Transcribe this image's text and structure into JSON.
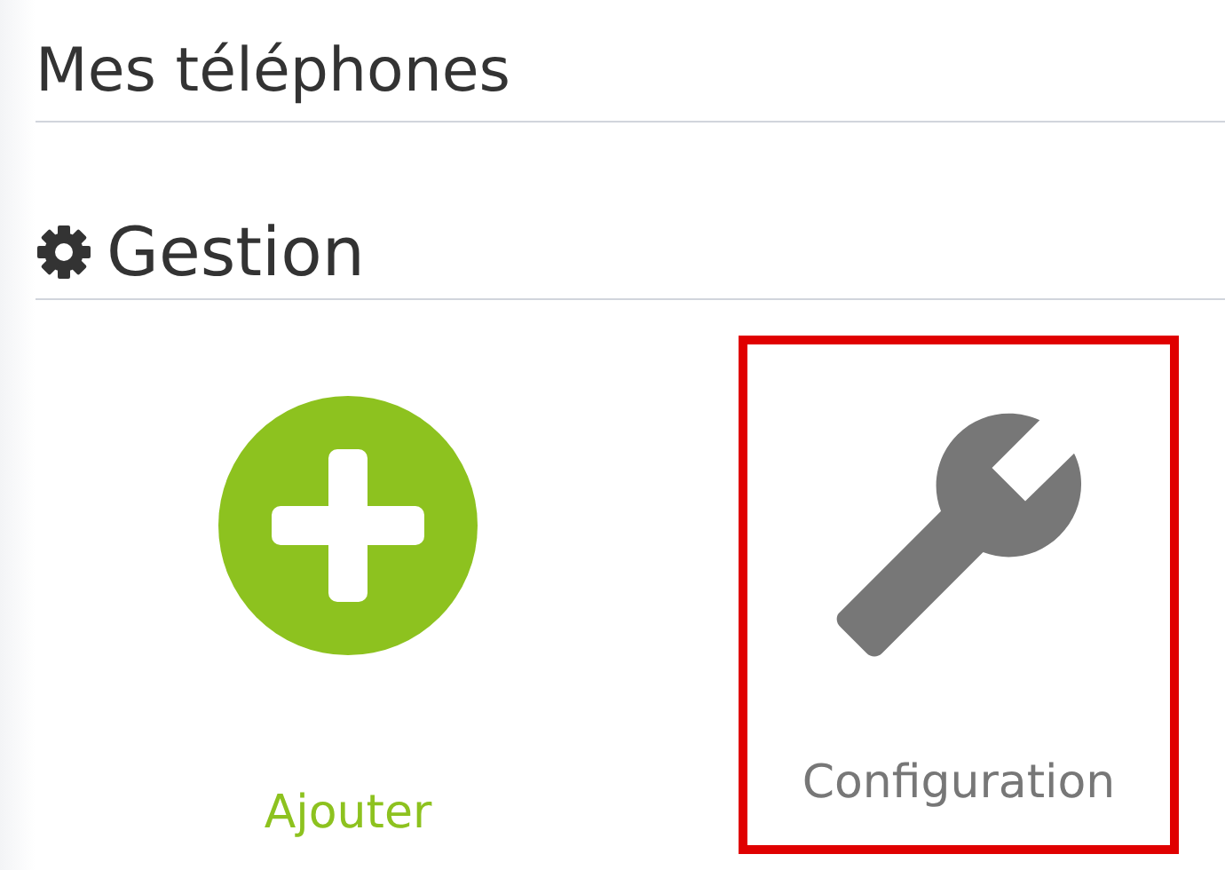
{
  "page_title": "Mes téléphones",
  "section": {
    "title": "Gestion"
  },
  "tiles": [
    {
      "kind": "add",
      "label": "Ajouter",
      "selected": false
    },
    {
      "kind": "config",
      "label": "Configuration",
      "selected": true
    }
  ]
}
